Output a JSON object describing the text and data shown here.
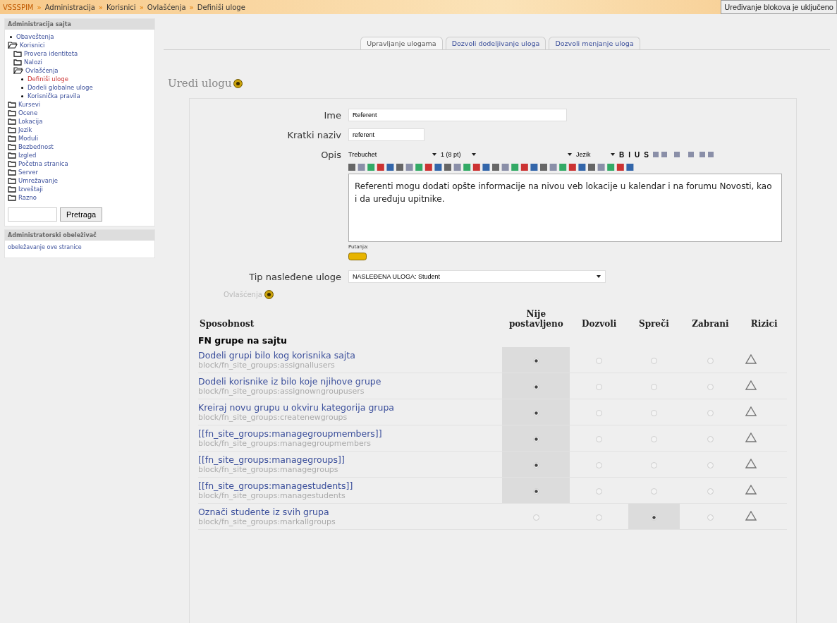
{
  "breadcrumb": [
    {
      "text": "VSSSPIM",
      "kind": "home"
    },
    {
      "text": "»",
      "kind": "sep"
    },
    {
      "text": "Administracija",
      "kind": "link"
    },
    {
      "text": "»",
      "kind": "sep"
    },
    {
      "text": "Korisnici",
      "kind": "link"
    },
    {
      "text": "»",
      "kind": "sep"
    },
    {
      "text": "Ovlašćenja",
      "kind": "link"
    },
    {
      "text": "»",
      "kind": "sep"
    },
    {
      "text": "Definiši uloge",
      "kind": "current"
    }
  ],
  "edit_button": "Uređivanje blokova je uključeno",
  "sidebar": {
    "title": "Administracija sajta",
    "items": [
      {
        "label": "Obaveštenja",
        "kind": "leaf",
        "selected": false
      },
      {
        "label": "Korisnici",
        "kind": "folder",
        "expanded": true,
        "children": [
          {
            "label": "Provera identiteta",
            "kind": "folder",
            "expanded": false
          },
          {
            "label": "Nalozi",
            "kind": "folder",
            "expanded": false
          },
          {
            "label": "Ovlašćenja",
            "kind": "folder",
            "expanded": true,
            "children": [
              {
                "label": "Definiši uloge",
                "kind": "leaf",
                "selected": true
              },
              {
                "label": "Dodeli globalne uloge",
                "kind": "leaf",
                "selected": false
              },
              {
                "label": "Korisnička pravila",
                "kind": "leaf",
                "selected": false
              }
            ]
          }
        ]
      },
      {
        "label": "Kursevi",
        "kind": "folder",
        "expanded": false
      },
      {
        "label": "Ocene",
        "kind": "folder",
        "expanded": false
      },
      {
        "label": "Lokacija",
        "kind": "folder",
        "expanded": false
      },
      {
        "label": "Jezik",
        "kind": "folder",
        "expanded": false
      },
      {
        "label": "Moduli",
        "kind": "folder",
        "expanded": false
      },
      {
        "label": "Bezbednost",
        "kind": "folder",
        "expanded": false
      },
      {
        "label": "Izgled",
        "kind": "folder",
        "expanded": false
      },
      {
        "label": "Početna stranica",
        "kind": "folder",
        "expanded": false
      },
      {
        "label": "Server",
        "kind": "folder",
        "expanded": false
      },
      {
        "label": "Umrežavanje",
        "kind": "folder",
        "expanded": false
      },
      {
        "label": "Izveštaji",
        "kind": "folder",
        "expanded": false
      },
      {
        "label": "Razno",
        "kind": "folder",
        "expanded": false
      }
    ],
    "search_button": "Pretraga",
    "bookmark_title": "Administratorski obeleživač",
    "bookmark_link": "obeležavanje ove stranice"
  },
  "tabs": [
    {
      "label": "Upravljanje ulogama",
      "selected": true
    },
    {
      "label": "Dozvoli dodeljivanje uloga",
      "selected": false
    },
    {
      "label": "Dozvoli menjanje uloga",
      "selected": false
    }
  ],
  "heading": "Uredi ulogu",
  "form": {
    "name_label": "Ime",
    "name_value": "Referent",
    "short_label": "Kratki naziv",
    "short_value": "referent",
    "desc_label": "Opis",
    "editor": {
      "font": "Trebuchet",
      "size": "1 (8 pt)",
      "language": "Jezik",
      "format_buttons": [
        "B",
        "I",
        "U",
        "S"
      ],
      "text": "Referenti mogu dodati opšte informacije na nivou veb lokacije u kalendar i na forumu Novosti, kao i da uređuju upitnike.",
      "path_label": "Putanja:"
    },
    "inherit_label": "Tip nasleđene uloge",
    "inherit_value": "NASLEĐENA ULOGA: Student"
  },
  "permissions": {
    "title": "Ovlašćenja",
    "columns": [
      "Sposobnost",
      "Nije postavljeno",
      "Dozvoli",
      "Spreči",
      "Zabrani",
      "Rizici"
    ],
    "group": "FN grupe na sajtu",
    "rows": [
      {
        "name": "Dodeli grupi bilo kog korisnika sajta",
        "code": "block/fn_site_groups:assignallusers",
        "options": [
          {
            "selected": true
          },
          {
            "selected": false
          },
          {
            "selected": false
          },
          {
            "selected": false
          }
        ]
      },
      {
        "name": "Dodeli korisnike iz bilo koje njihove grupe",
        "code": "block/fn_site_groups:assignowngroupusers",
        "options": [
          {
            "selected": true
          },
          {
            "selected": false
          },
          {
            "selected": false
          },
          {
            "selected": false
          }
        ]
      },
      {
        "name": "Kreiraj novu grupu u okviru kategorija grupa",
        "code": "block/fn_site_groups:createnewgroups",
        "options": [
          {
            "selected": true
          },
          {
            "selected": false
          },
          {
            "selected": false
          },
          {
            "selected": false
          }
        ]
      },
      {
        "name": "[[fn_site_groups:managegroupmembers]]",
        "code": "block/fn_site_groups:managegroupmembers",
        "options": [
          {
            "selected": true
          },
          {
            "selected": false
          },
          {
            "selected": false
          },
          {
            "selected": false
          }
        ]
      },
      {
        "name": "[[fn_site_groups:managegroups]]",
        "code": "block/fn_site_groups:managegroups",
        "options": [
          {
            "selected": true
          },
          {
            "selected": false
          },
          {
            "selected": false
          },
          {
            "selected": false
          }
        ]
      },
      {
        "name": "[[fn_site_groups:managestudents]]",
        "code": "block/fn_site_groups:managestudents",
        "options": [
          {
            "selected": true
          },
          {
            "selected": false
          },
          {
            "selected": false
          },
          {
            "selected": false
          }
        ]
      },
      {
        "name": "Označi studente iz svih grupa",
        "code": "block/fn_site_groups:markallgroups",
        "options": [
          {
            "selected": false
          },
          {
            "selected": false
          },
          {
            "selected": true
          },
          {
            "selected": false
          }
        ]
      }
    ]
  }
}
